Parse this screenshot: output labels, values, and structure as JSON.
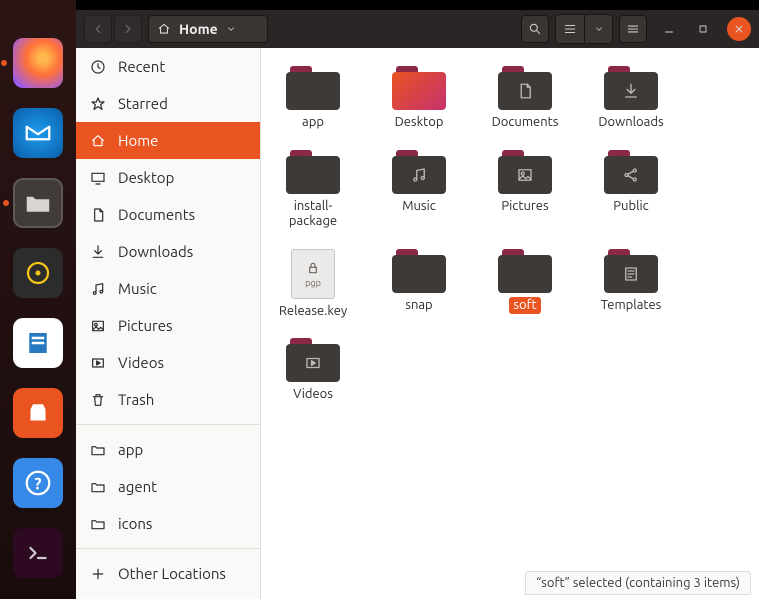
{
  "titlebar": {
    "path_label": "Home"
  },
  "sidebar": {
    "items": [
      {
        "label": "Recent",
        "icon": "clock"
      },
      {
        "label": "Starred",
        "icon": "star"
      },
      {
        "label": "Home",
        "icon": "home",
        "active": true
      },
      {
        "label": "Desktop",
        "icon": "desktop"
      },
      {
        "label": "Documents",
        "icon": "document"
      },
      {
        "label": "Downloads",
        "icon": "download"
      },
      {
        "label": "Music",
        "icon": "music"
      },
      {
        "label": "Pictures",
        "icon": "picture"
      },
      {
        "label": "Videos",
        "icon": "video"
      },
      {
        "label": "Trash",
        "icon": "trash"
      }
    ],
    "extras": [
      {
        "label": "app",
        "icon": "folder"
      },
      {
        "label": "agent",
        "icon": "folder"
      },
      {
        "label": "icons",
        "icon": "folder"
      }
    ],
    "other_locations": "Other Locations"
  },
  "files": [
    {
      "name": "app",
      "type": "folder"
    },
    {
      "name": "Desktop",
      "type": "folder-gradient"
    },
    {
      "name": "Documents",
      "type": "folder",
      "glyph": "document"
    },
    {
      "name": "Downloads",
      "type": "folder",
      "glyph": "download"
    },
    {
      "name": "install-package",
      "type": "folder"
    },
    {
      "name": "Music",
      "type": "folder",
      "glyph": "music"
    },
    {
      "name": "Pictures",
      "type": "folder",
      "glyph": "picture"
    },
    {
      "name": "Public",
      "type": "folder",
      "glyph": "share"
    },
    {
      "name": "Release.key",
      "type": "file-pgp"
    },
    {
      "name": "snap",
      "type": "folder"
    },
    {
      "name": "soft",
      "type": "folder",
      "selected": true
    },
    {
      "name": "Templates",
      "type": "folder",
      "glyph": "template"
    },
    {
      "name": "Videos",
      "type": "folder",
      "glyph": "video"
    }
  ],
  "pgp_label": "pgp",
  "status": "“soft” selected  (containing 3 items)"
}
